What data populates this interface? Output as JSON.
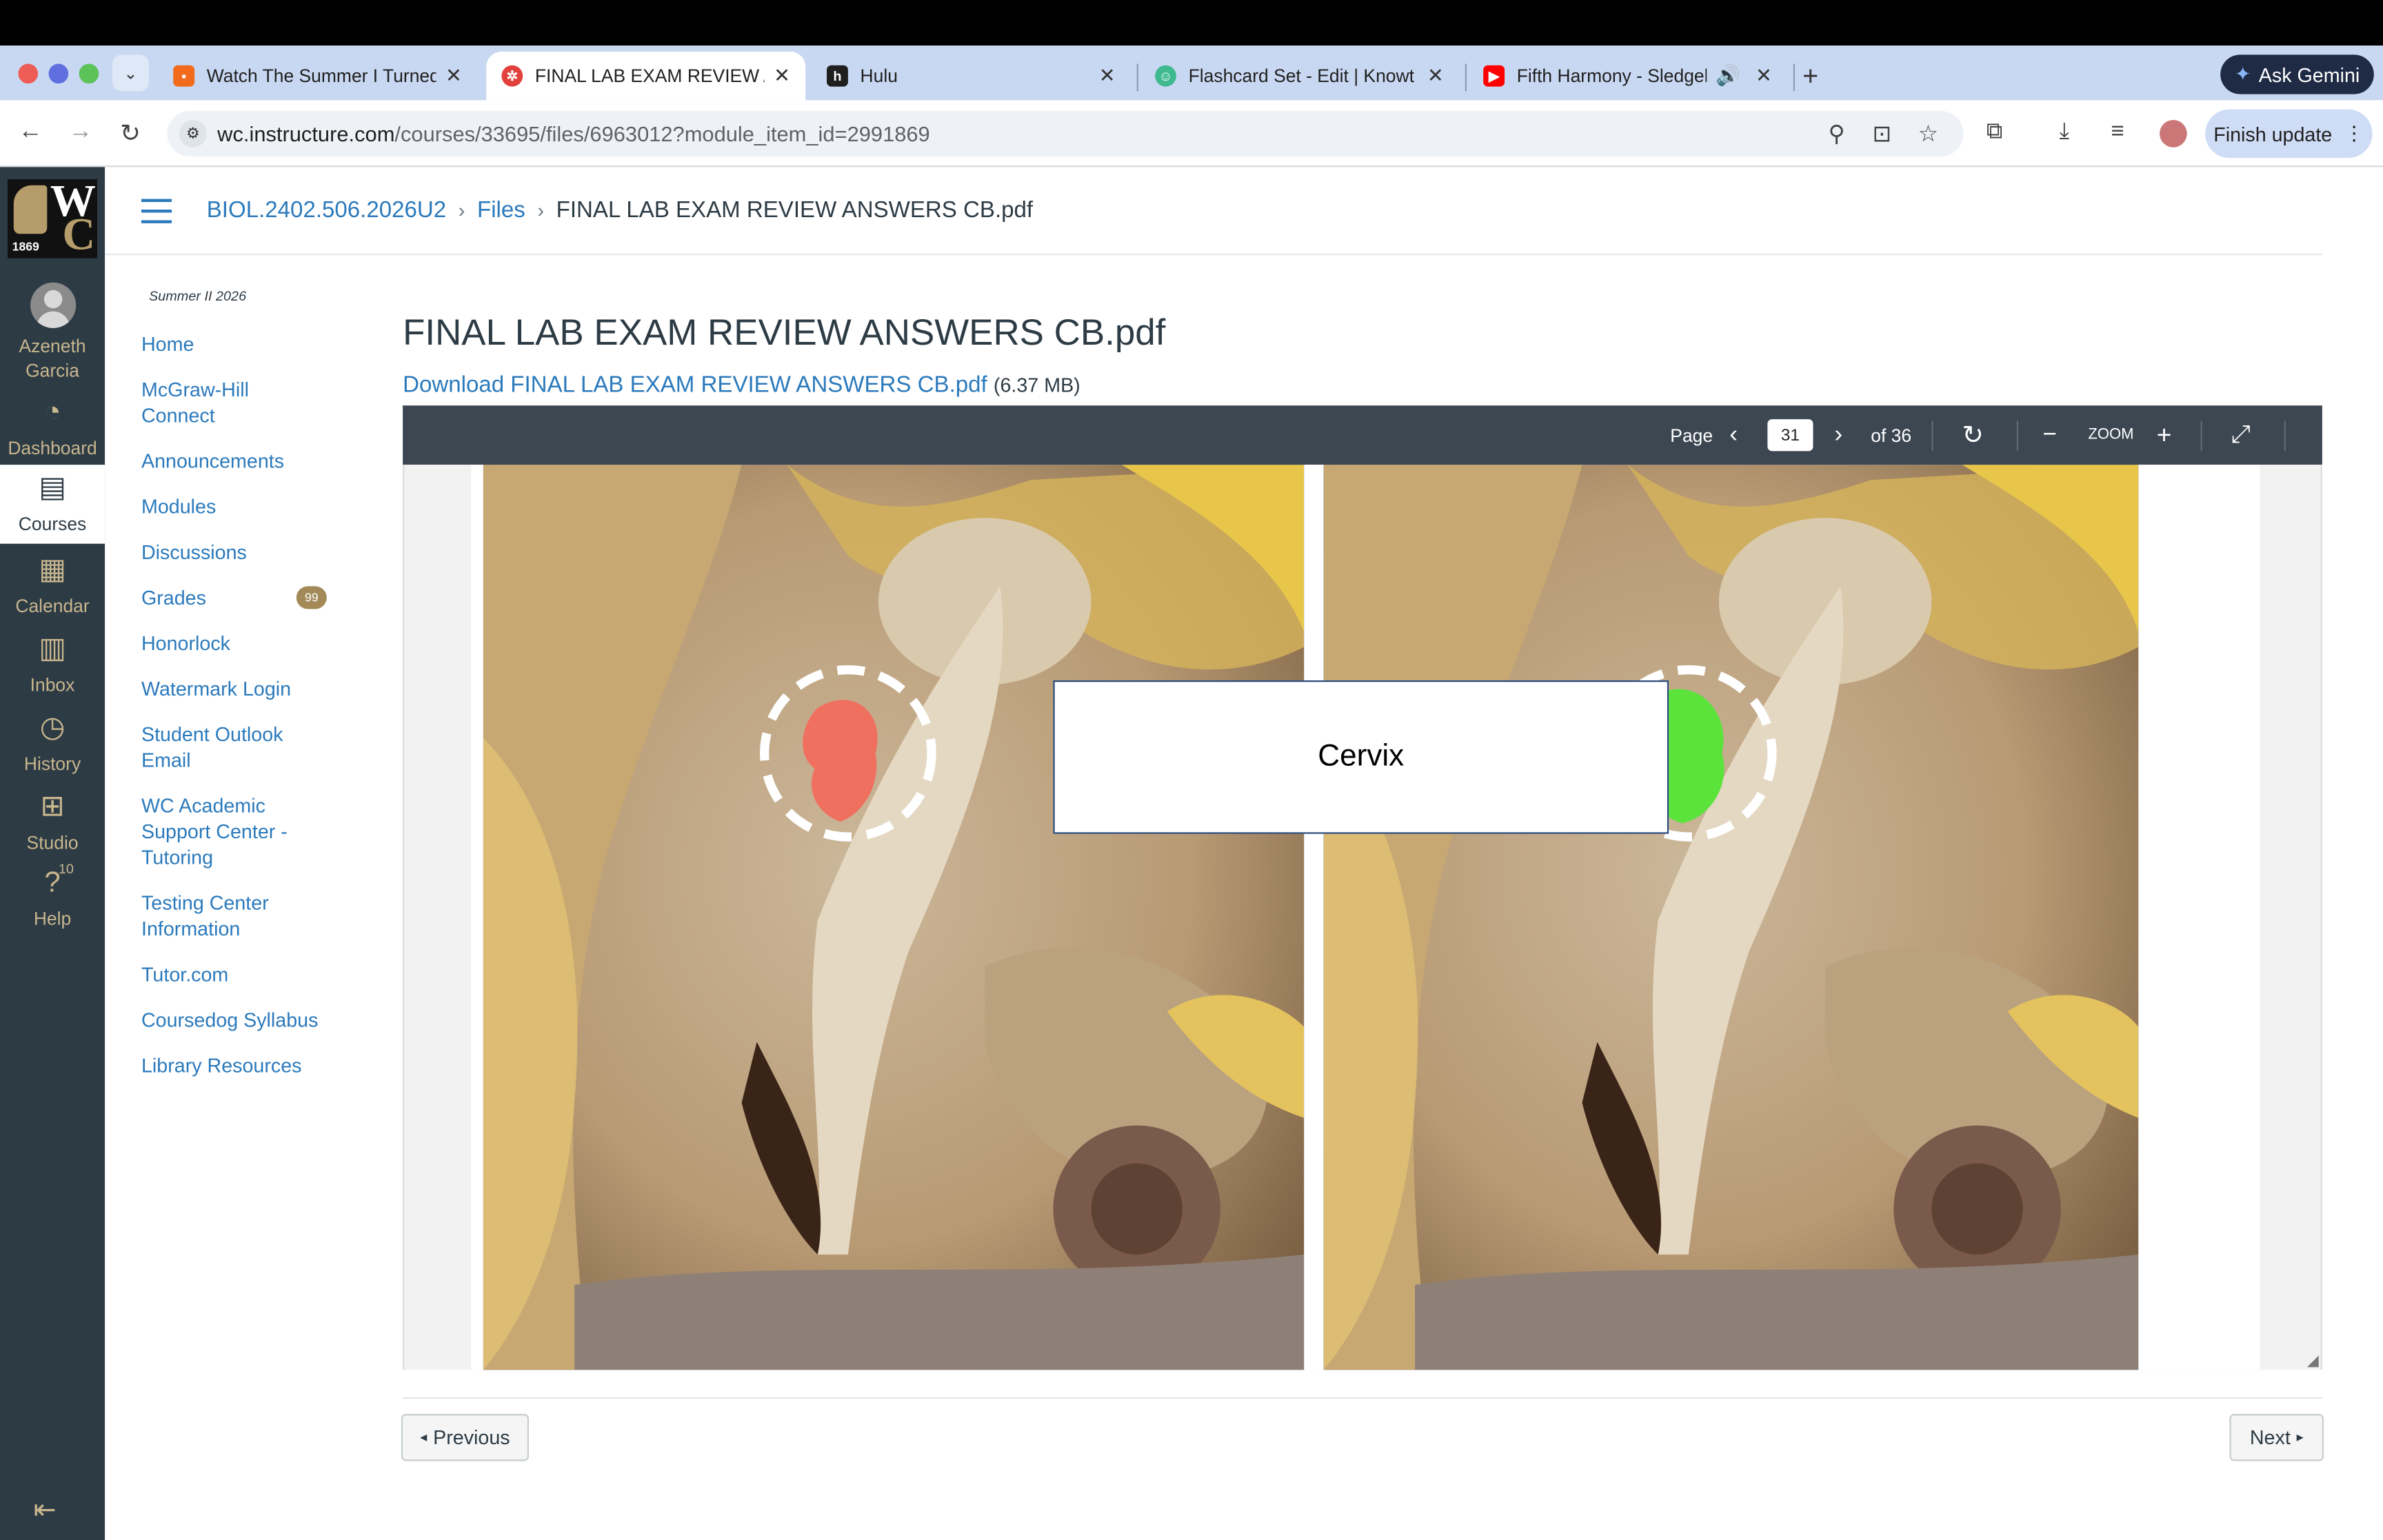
{
  "browser": {
    "tabs": [
      {
        "title": "Watch The Summer I Turned P",
        "favicon_color": "#f26b1d"
      },
      {
        "title": "FINAL LAB EXAM REVIEW AN",
        "favicon_color": "#e2403d",
        "active": true
      },
      {
        "title": "Hulu",
        "favicon_color": "#1f1f1f"
      },
      {
        "title": "Flashcard Set - Edit | Knowt",
        "favicon_color": "#3fb98e"
      },
      {
        "title": "Fifth Harmony - Sledgeha",
        "favicon_color": "#ff0000"
      }
    ],
    "ask_gemini": "Ask Gemini",
    "url_host": "wc.instructure.com",
    "url_path": "/courses/33695/files/6963012?module_item_id=2991869",
    "finish_update": "Finish update"
  },
  "global_nav": {
    "logo_year": "1869",
    "user_name": "Azeneth Garcia",
    "items": [
      {
        "label": "Dashboard",
        "icon": "dashboard-icon"
      },
      {
        "label": "Courses",
        "icon": "courses-icon",
        "active": true
      },
      {
        "label": "Calendar",
        "icon": "calendar-icon"
      },
      {
        "label": "Inbox",
        "icon": "inbox-icon"
      },
      {
        "label": "History",
        "icon": "history-icon"
      },
      {
        "label": "Studio",
        "icon": "studio-icon"
      },
      {
        "label": "Help",
        "icon": "help-icon",
        "badge": "10"
      }
    ]
  },
  "breadcrumb": {
    "course": "BIOL.2402.506.2026U2",
    "files": "Files",
    "current": "FINAL LAB EXAM REVIEW ANSWERS CB.pdf"
  },
  "course_nav": {
    "term": "Summer II 2026",
    "items": [
      {
        "label": "Home"
      },
      {
        "label": "McGraw-Hill Connect"
      },
      {
        "label": "Announcements"
      },
      {
        "label": "Modules"
      },
      {
        "label": "Discussions"
      },
      {
        "label": "Grades",
        "badge": "99"
      },
      {
        "label": "Honorlock"
      },
      {
        "label": "Watermark Login"
      },
      {
        "label": "Student Outlook Email"
      },
      {
        "label": "WC Academic Support Center - Tutoring"
      },
      {
        "label": "Testing Center Information"
      },
      {
        "label": "Tutor.com"
      },
      {
        "label": "Coursedog Syllabus"
      },
      {
        "label": "Library Resources"
      }
    ]
  },
  "file": {
    "title": "FINAL LAB EXAM REVIEW ANSWERS CB.pdf",
    "download_label": "Download FINAL LAB EXAM REVIEW ANSWERS CB.pdf",
    "size": "(6.37 MB)"
  },
  "viewer": {
    "page_label": "Page",
    "current_page": "31",
    "total_label": "of 36",
    "zoom_label": "ZOOM",
    "slide_label": "Cervix",
    "highlight_colors": {
      "left": "#f07060",
      "right": "#5be33c"
    }
  },
  "pager": {
    "previous": "Previous",
    "next": "Next"
  }
}
